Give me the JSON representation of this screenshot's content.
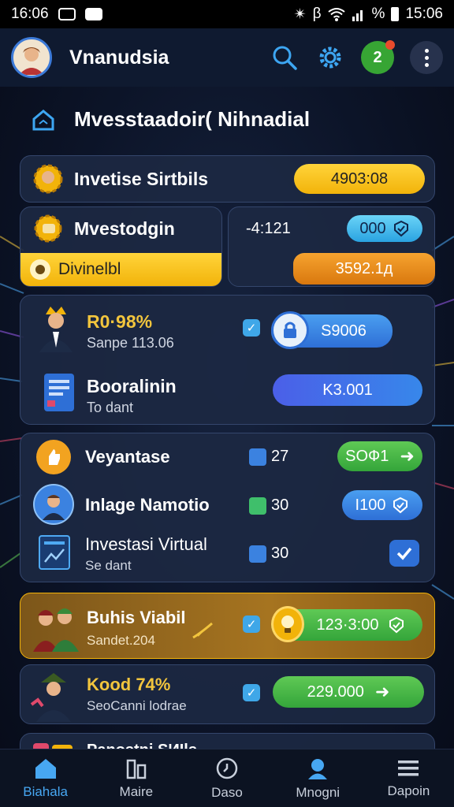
{
  "status_bar": {
    "time_left": "16:06",
    "time_right": "15:06",
    "signal_percent": "%"
  },
  "header": {
    "title": "Vnanudsia",
    "notification_count": "2"
  },
  "section": {
    "title": "Mvesstaadoir( Nihnadial"
  },
  "summary": {
    "investments_label": "Invetise Sirtbils",
    "investments_value": "4903:08",
    "mvestodgin_label": "Mvestodgin",
    "dividend_label": "Divinelbl",
    "small_value": "-4:121",
    "small_badge": "000",
    "orange_value": "3592.1д"
  },
  "group1": {
    "row1": {
      "title": "R0·98%",
      "subtitle": "Sanpe 113.06",
      "amount": "S9006"
    },
    "row2": {
      "title": "Booralinin",
      "subtitle": "To dant",
      "amount": "K3.001"
    }
  },
  "group2": {
    "row1": {
      "title": "Veyantase",
      "count": "27",
      "button": "SOФ1"
    },
    "row2": {
      "title": "Inlage Namotio",
      "count": "30",
      "button": "I100"
    },
    "row3": {
      "title": "Investasi Virtual",
      "subtitle": "Se dant",
      "count": "30"
    }
  },
  "featured": {
    "title": "Buhis Viabil",
    "subtitle": "Sandet.204",
    "amount": "123·3:00"
  },
  "row_last": {
    "title": "Kood 74%",
    "subtitle": "SeoCanni lodrae",
    "amount": "229.000"
  },
  "partial_row": {
    "title": "Panostni SИIls"
  },
  "bottom_nav": [
    {
      "label": "Biahala"
    },
    {
      "label": "Maire"
    },
    {
      "label": "Daso"
    },
    {
      "label": "Mnogni"
    },
    {
      "label": "Dapoin"
    }
  ],
  "colors": {
    "accent": "#47a7f2",
    "yellow": "#f2b30a",
    "orange": "#d9780e",
    "green": "#34a53a"
  }
}
